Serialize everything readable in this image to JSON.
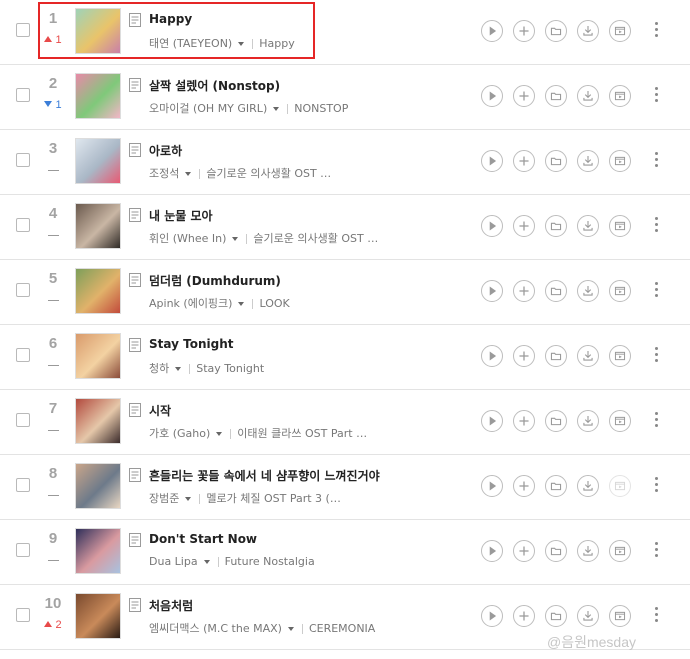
{
  "songs": [
    {
      "rank": "1",
      "change": "up",
      "change_value": "1",
      "title": "Happy",
      "artist": "태연 (TAEYEON)",
      "album": "Happy",
      "cover_colors": [
        "#9fd3b8",
        "#e9c46a",
        "#c97fa9"
      ]
    },
    {
      "rank": "2",
      "change": "down",
      "change_value": "1",
      "title": "살짝 설렜어 (Nonstop)",
      "artist": "오마이걸 (OH MY GIRL)",
      "album": "NONSTOP",
      "cover_colors": [
        "#e88aa8",
        "#7fc97a",
        "#f3b6c8"
      ]
    },
    {
      "rank": "3",
      "change": "none",
      "change_value": "",
      "title": "아로하",
      "artist": "조정석",
      "album": "슬기로운 의사생활 OST …",
      "cover_colors": [
        "#dfe7ee",
        "#a9b7c6",
        "#e85a73"
      ]
    },
    {
      "rank": "4",
      "change": "none",
      "change_value": "",
      "title": "내 눈물 모아",
      "artist": "휘인 (Whee In)",
      "album": "슬기로운 의사생활 OST …",
      "cover_colors": [
        "#6b5a4e",
        "#c9b6a4",
        "#2f2a26"
      ]
    },
    {
      "rank": "5",
      "change": "none",
      "change_value": "",
      "title": "덤더럼 (Dumhdurum)",
      "artist": "Apink (에이핑크)",
      "album": "LOOK",
      "cover_colors": [
        "#7e9f5a",
        "#e1b26a",
        "#c24b3b"
      ]
    },
    {
      "rank": "6",
      "change": "none",
      "change_value": "",
      "title": "Stay Tonight",
      "artist": "청하",
      "album": "Stay Tonight",
      "cover_colors": [
        "#d99b6c",
        "#f3d2a2",
        "#8a4b3a"
      ]
    },
    {
      "rank": "7",
      "change": "none",
      "change_value": "",
      "title": "시작",
      "artist": "가호 (Gaho)",
      "album": "이태원 클라쓰 OST Part …",
      "cover_colors": [
        "#b24a3e",
        "#e5c7a9",
        "#3b2b2b"
      ]
    },
    {
      "rank": "8",
      "change": "none",
      "change_value": "",
      "title": "흔들리는 꽃들 속에서 네 샴푸향이 느껴진거야",
      "artist": "장범준",
      "album": "멜로가 체질 OST Part 3 (…",
      "cover_colors": [
        "#c9a58a",
        "#6d7a8a",
        "#e9d7c3"
      ]
    },
    {
      "rank": "9",
      "change": "none",
      "change_value": "",
      "title": "Don't Start Now",
      "artist": "Dua Lipa",
      "album": "Future Nostalgia",
      "cover_colors": [
        "#2f2f5a",
        "#d99aa0",
        "#a8c2e0"
      ]
    },
    {
      "rank": "10",
      "change": "up",
      "change_value": "2",
      "title": "처음처럼",
      "artist": "엠씨더맥스 (M.C the MAX)",
      "album": "CEREMONIA",
      "cover_colors": [
        "#7a4a2e",
        "#c98a5a",
        "#2a1b14"
      ]
    }
  ],
  "icons": {
    "lyrics": "lyrics-icon",
    "play": "play-icon",
    "add": "add-icon",
    "folder": "folder-icon",
    "download": "download-icon",
    "music_video": "music-video-icon",
    "more": "more-options-icon"
  },
  "colors": {
    "highlight": "#e52626",
    "up": "#e84a4a",
    "down": "#3b7ed8"
  },
  "watermark": "@음원mesday"
}
